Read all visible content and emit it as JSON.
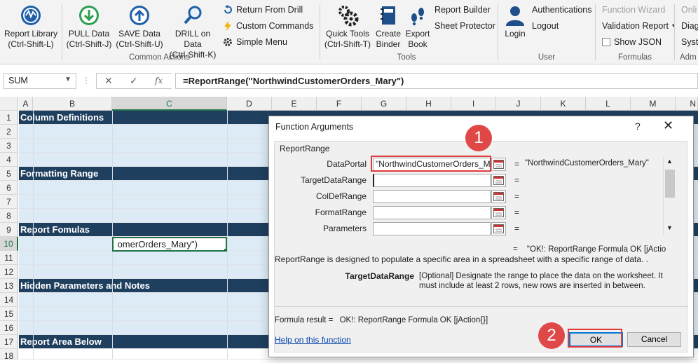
{
  "ribbon": {
    "buttons": [
      {
        "label": "Report Library",
        "sub": "(Ctrl-Shift-L)"
      },
      {
        "label": "PULL Data",
        "sub": "(Ctrl-Shift-J)"
      },
      {
        "label": "SAVE Data",
        "sub": "(Ctrl-Shift-U)"
      },
      {
        "label": "DRILL on Data",
        "sub": "(Ctrl-Shift-K)"
      }
    ],
    "small_items": [
      "Return From Drill",
      "Custom Commands",
      "Simple Menu"
    ],
    "tools": [
      {
        "label": "Quick Tools",
        "sub": "(Ctrl-Shift-T)"
      },
      {
        "label": "Create",
        "sub": "Binder"
      },
      {
        "label": "Export",
        "sub": "Book"
      }
    ],
    "tools_small": [
      "Report Builder",
      "Sheet Protector"
    ],
    "user": {
      "login": "Login",
      "authentications": "Authentications",
      "logout": "Logout"
    },
    "formulas": {
      "function_wizard": "Function Wizard",
      "validation_report": "Validation Report",
      "show_json": "Show JSON"
    },
    "cut_off": [
      "Onli",
      "Diag",
      "Syst",
      "Adm"
    ],
    "groups": {
      "common_actions": "Common Actions",
      "tools": "Tools",
      "user": "User",
      "formulas": "Formulas"
    }
  },
  "formula_bar": {
    "name_box": "SUM",
    "cancel": "✕",
    "enter": "✓",
    "fx": "fx",
    "formula": "=ReportRange(\"NorthwindCustomerOrders_Mary\")"
  },
  "grid": {
    "columns": [
      "A",
      "B",
      "C",
      "D",
      "E",
      "F",
      "G",
      "H",
      "I",
      "J",
      "K",
      "L",
      "M",
      "N"
    ],
    "rows": [
      "1",
      "2",
      "3",
      "4",
      "5",
      "6",
      "7",
      "8",
      "9",
      "10",
      "11",
      "12",
      "13",
      "14",
      "15",
      "16",
      "17",
      "18"
    ],
    "bands": [
      "Column Definitions",
      "Formatting Range",
      "Report Fomulas",
      "Hidden Parameters and Notes",
      "Report Area Below"
    ],
    "active_cell_text": "omerOrders_Mary\")"
  },
  "dialog": {
    "title": "Function Arguments",
    "help": "?",
    "close": "✕",
    "function_name": "ReportRange",
    "args": [
      {
        "label": "DataPortal",
        "value": "\"NorthwindCustomerOrders_Ma",
        "result": "\"NorthwindCustomerOrders_Mary\""
      },
      {
        "label": "TargetDataRange",
        "value": "",
        "result": ""
      },
      {
        "label": "ColDefRange",
        "value": "",
        "result": ""
      },
      {
        "label": "FormatRange",
        "value": "",
        "result": ""
      },
      {
        "label": "Parameters",
        "value": "",
        "result": ""
      }
    ],
    "eq": "=",
    "result_preview": "\"OK!: ReportRange Formula OK [jActio",
    "description": "ReportRange is designed to populate a specific area in a spreadsheet with a specific range of data. .",
    "arg_desc_label": "TargetDataRange",
    "arg_desc_text": "[Optional] Designate the range to place the data on the worksheet. It must include at least 2 rows, new rows are inserted in between.",
    "formula_result_label": "Formula result =",
    "formula_result_value": "OK!: ReportRange Formula OK [jAction{}]",
    "help_link": "Help on this function",
    "ok": "OK",
    "cancel": "Cancel"
  },
  "annotations": {
    "badge1": "1",
    "badge2": "2"
  },
  "colors": {
    "band": "#1f3f5f",
    "fill": "#ddebf7",
    "excel_green": "#217346",
    "annotation_red": "#e04848"
  }
}
